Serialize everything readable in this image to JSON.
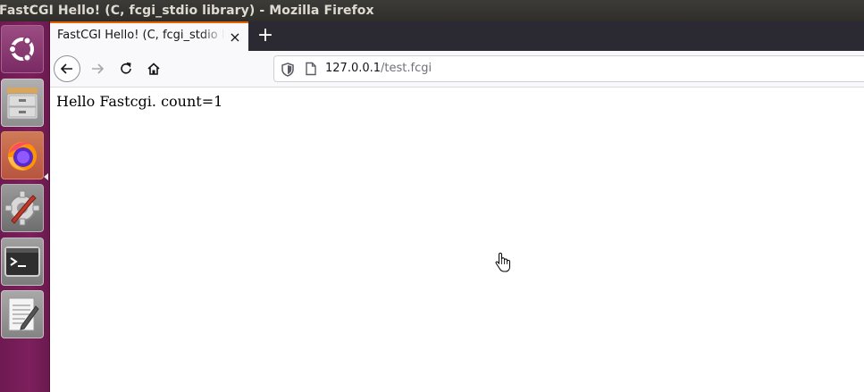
{
  "window": {
    "title": "FastCGI Hello! (C, fcgi_stdio library) - Mozilla Firefox"
  },
  "launcher": {
    "items": [
      {
        "name": "ubuntu-dash",
        "icon": "ubuntu-logo-icon"
      },
      {
        "name": "files",
        "icon": "file-cabinet-icon"
      },
      {
        "name": "firefox",
        "icon": "firefox-icon",
        "active": true
      },
      {
        "name": "system-settings",
        "icon": "settings-wrench-icon"
      },
      {
        "name": "terminal",
        "icon": "terminal-icon"
      },
      {
        "name": "text-editor",
        "icon": "text-editor-icon"
      }
    ],
    "colors": {
      "background": "#7d1f5d"
    }
  },
  "browser": {
    "tab": {
      "title": "FastCGI Hello! (C, fcgi_stdio library)",
      "close": "×"
    },
    "new_tab": "+",
    "url": {
      "host": "127.0.0.1",
      "path": "/test.fcgi"
    },
    "colors": {
      "accent": "#e66000",
      "tabstrip": "#2b2a33"
    }
  },
  "page": {
    "text": "Hello Fastcgi. count=1"
  }
}
